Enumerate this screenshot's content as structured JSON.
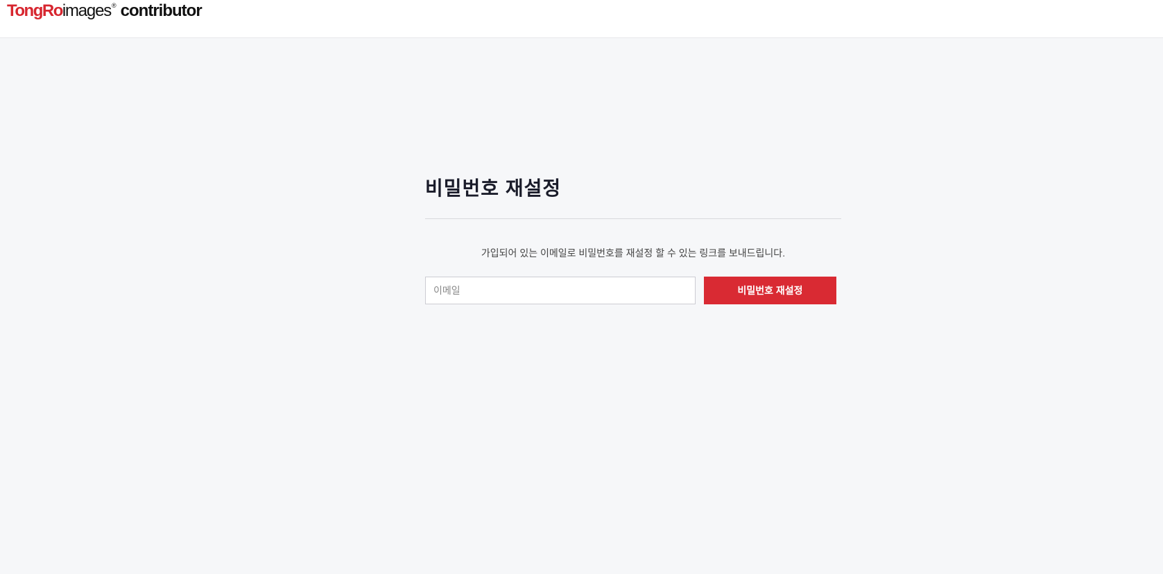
{
  "header": {
    "logo": {
      "tongro": "TongRo",
      "images": "images",
      "registered": "®",
      "contributor": "contributor"
    }
  },
  "main": {
    "title": "비밀번호 재설정",
    "instruction": "가입되어 있는 이메일로 비밀번호를 재설정 할 수 있는 링크를 보내드립니다.",
    "email_input": {
      "placeholder": "이메일",
      "value": ""
    },
    "reset_button_label": "비밀번호 재설정"
  },
  "colors": {
    "brand_red": "#d92a33",
    "background": "#f6f7f9",
    "header_background": "#ffffff"
  }
}
